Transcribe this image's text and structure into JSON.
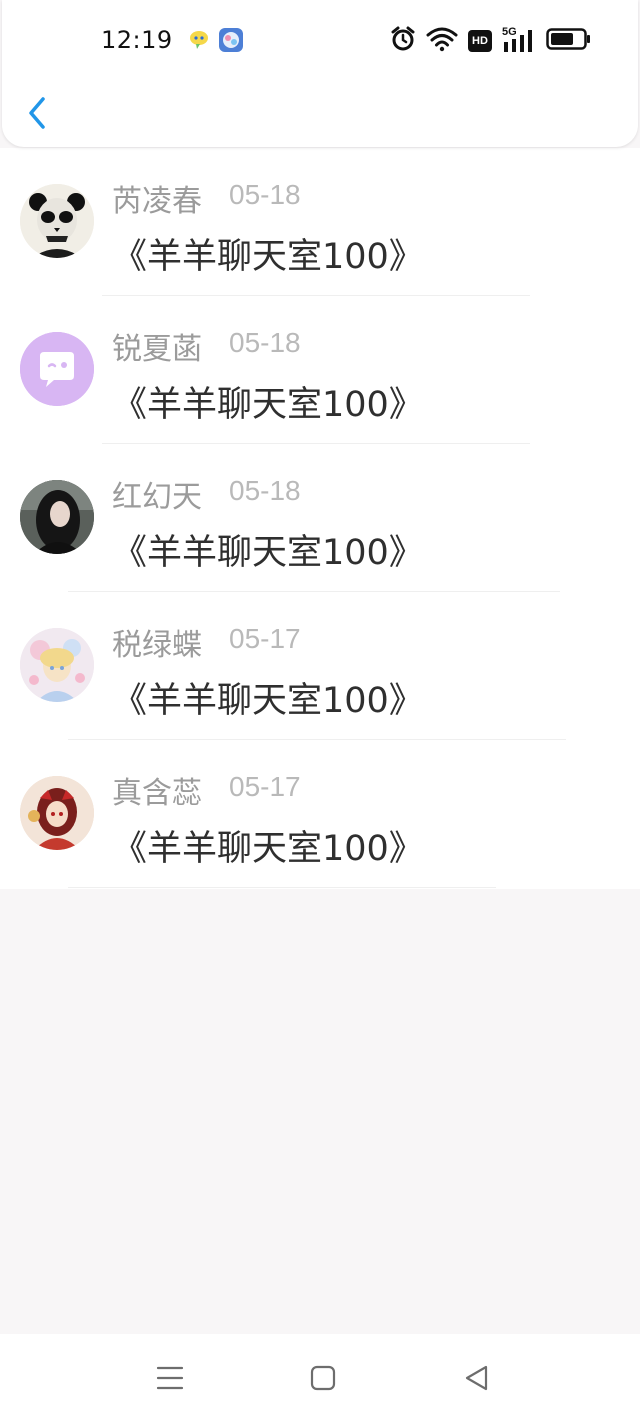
{
  "status_bar": {
    "time": "12:19",
    "left_icons": [
      "chat-bubble-app-icon",
      "game-app-icon"
    ],
    "right_icons": [
      "alarm-icon",
      "wifi-icon",
      "hd-badge-icon",
      "5g-signal-icon",
      "battery-icon"
    ],
    "hd_label": "HD",
    "network_label": "5G"
  },
  "header": {
    "back_icon": "chevron-left-icon"
  },
  "colors": {
    "accent": "#2196e8",
    "name_text": "#9b9b9b",
    "date_text": "#b9b9b9",
    "subtitle_text": "#2f2f2f",
    "background": "#f8f6f7"
  },
  "list": {
    "items": [
      {
        "name": "芮凌春",
        "date": "05-18",
        "subtitle": "《羊羊聊天室100》",
        "avatar": "panda-skull-avatar"
      },
      {
        "name": "锐夏菡",
        "date": "05-18",
        "subtitle": "《羊羊聊天室100》",
        "avatar": "purple-chat-avatar"
      },
      {
        "name": "红幻天",
        "date": "05-18",
        "subtitle": "《羊羊聊天室100》",
        "avatar": "dark-hair-girl-avatar"
      },
      {
        "name": "税绿蝶",
        "date": "05-17",
        "subtitle": "《羊羊聊天室100》",
        "avatar": "anime-pastel-avatar"
      },
      {
        "name": "真含蕊",
        "date": "05-17",
        "subtitle": "《羊羊聊天室100》",
        "avatar": "anime-red-avatar"
      }
    ]
  },
  "nav_bar": {
    "buttons": [
      "menu-icon",
      "home-square-icon",
      "back-triangle-icon"
    ]
  }
}
